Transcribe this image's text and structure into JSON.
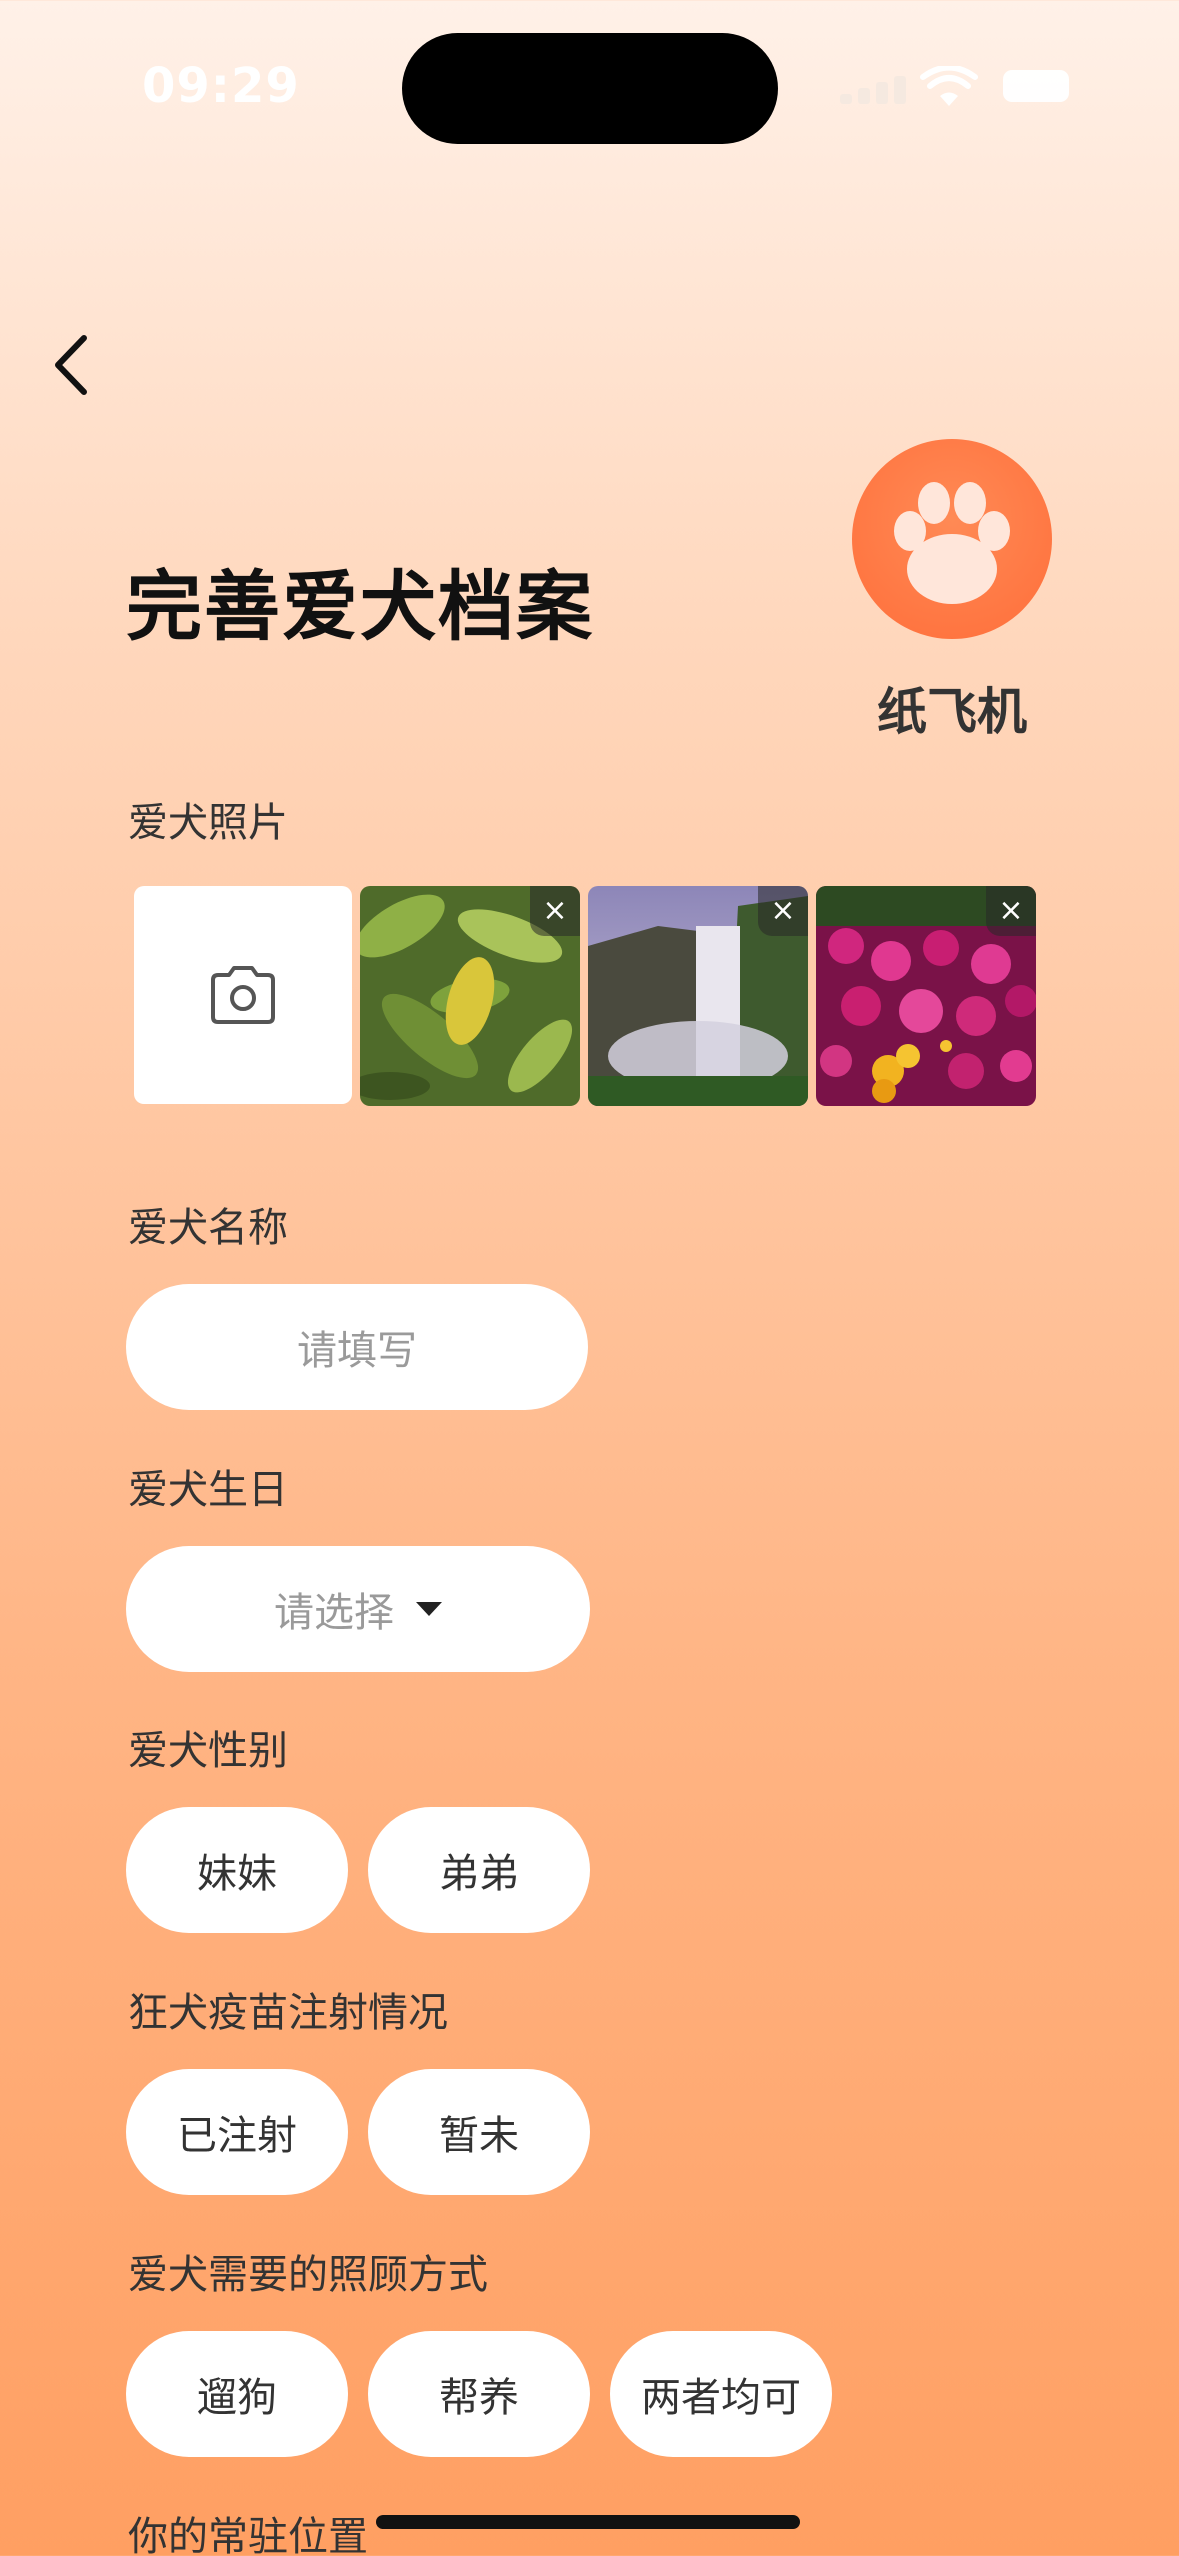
{
  "status_bar": {
    "time": "09:29"
  },
  "header": {
    "title": "完善爱犬档案",
    "nickname": "纸飞机"
  },
  "sections": {
    "photos_label": "爱犬照片",
    "name_label": "爱犬名称",
    "name_placeholder": "请填写",
    "birthday_label": "爱犬生日",
    "birthday_placeholder": "请选择",
    "gender_label": "爱犬性别",
    "gender_options": [
      "妹妹",
      "弟弟"
    ],
    "vaccine_label": "狂犬疫苗注射情况",
    "vaccine_options": [
      "已注射",
      "暂未"
    ],
    "care_label": "爱犬需要的照顾方式",
    "care_options": [
      "遛狗",
      "帮养",
      "两者均可"
    ],
    "location_label": "你的常驻位置"
  },
  "photos": [
    {
      "subject": "green-leaves",
      "close_label": "×"
    },
    {
      "subject": "waterfall",
      "close_label": "×"
    },
    {
      "subject": "magenta-flowers",
      "close_label": "×"
    }
  ],
  "colors": {
    "accent": "#FF7A45",
    "background_top": "#FFF1E8",
    "background_bottom": "#FF9F62"
  }
}
